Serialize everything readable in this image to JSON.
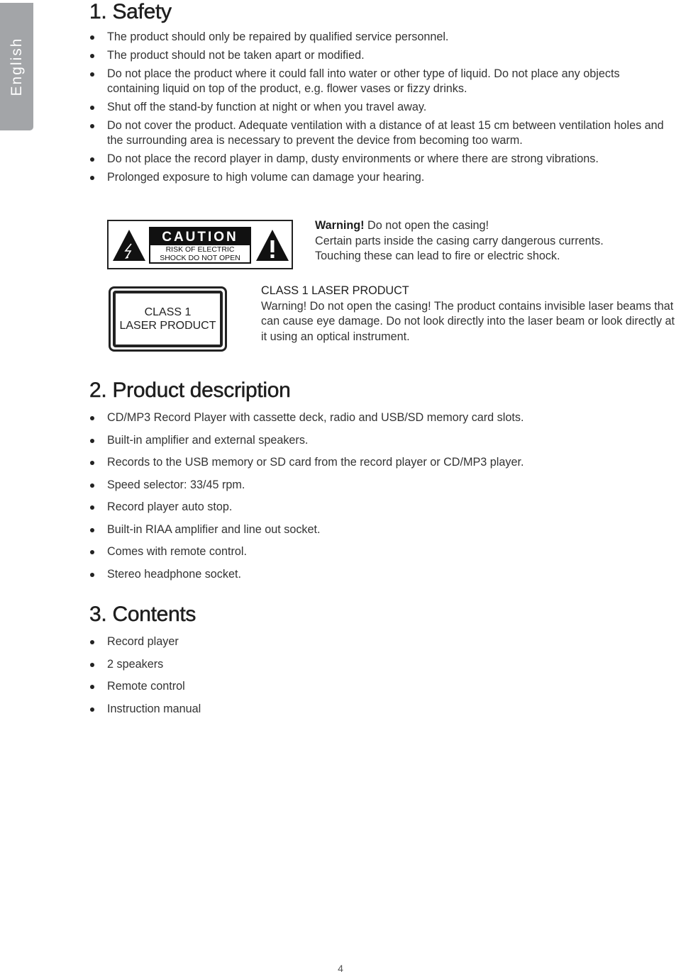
{
  "language_tab": "English",
  "sections": {
    "safety": {
      "heading": "1. Safety",
      "items": [
        "The product should only be repaired by qualified service personnel.",
        "The product should not be taken apart or modified.",
        "Do not place the product where it could fall into water or other type of liquid. Do not place any objects containing liquid on top of the product, e.g. flower vases or fizzy drinks.",
        "Shut off the stand-by function at night or when you travel away.",
        "Do not cover the product. Adequate ventilation with a distance of at least 15 cm between ventilation holes and the surrounding area is necessary to prevent the device from becoming too warm.",
        "Do not place the record player in damp, dusty environments or where there are strong vibrations.",
        "Prolonged exposure to high volume can damage your hearing."
      ]
    },
    "caution_label": {
      "icons": [
        "electric-shock-warning-icon",
        "exclamation-warning-icon"
      ],
      "head": "CAUTION",
      "line1": "RISK OF ELECTRIC",
      "line2": "SHOCK DO NOT OPEN"
    },
    "caution_text": {
      "bold": "Warning!",
      "line1_rest": " Do not open the casing!",
      "line2": "Certain parts inside the casing carry dangerous currents.",
      "line3": "Touching these can lead to fire or electric shock."
    },
    "laser_label": {
      "line1": "CLASS 1",
      "line2": "LASER PRODUCT"
    },
    "laser_text": {
      "title": "CLASS 1 LASER PRODUCT",
      "body": "Warning! Do not open the casing! The product contains invisible laser beams that can cause eye damage. Do not look directly into the laser beam or look directly at it using an optical instrument."
    },
    "product_description": {
      "heading": "2. Product description",
      "items": [
        "CD/MP3 Record Player with cassette deck, radio and USB/SD memory card slots.",
        "Built-in amplifier and external speakers.",
        "Records to the USB memory or SD card from the record player or CD/MP3 player.",
        "Speed selector: 33/45 rpm.",
        "Record player auto stop.",
        "Built-in RIAA amplifier and line out socket.",
        "Comes with remote control.",
        "Stereo headphone socket."
      ]
    },
    "contents": {
      "heading": "3. Contents",
      "items": [
        "Record player",
        "2 speakers",
        "Remote control",
        "Instruction manual"
      ]
    }
  },
  "page_number": "4"
}
